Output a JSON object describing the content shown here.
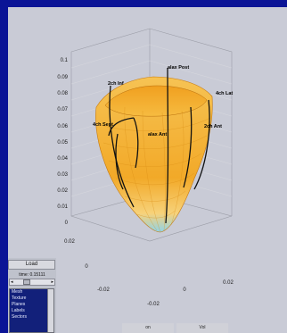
{
  "plot": {
    "z_ticks": [
      "0.1",
      "0.09",
      "0.08",
      "0.07",
      "0.06",
      "0.05",
      "0.04",
      "0.03",
      "0.02",
      "0.01",
      "0"
    ],
    "x_ticks": [
      "0.02",
      "0",
      "-0.02"
    ],
    "y_ticks": [
      "-0.02",
      "0",
      "0.02"
    ],
    "labels": {
      "two_ch_inf": "2ch Inf",
      "alax_post": "alax Post",
      "four_ch_lat": "4ch Lat",
      "four_ch_sept": "4ch Sept",
      "alax_ant": "alax Ant",
      "two_ch_ant": "2ch Ant"
    }
  },
  "controls": {
    "load_label": "Load",
    "time_label": "time: 0.15111",
    "slider_left": "◂",
    "slider_right": "▸",
    "list_items": [
      "Mesh",
      "Texture",
      "Planes",
      "Labels",
      "Sectors"
    ],
    "tab1_label": "on",
    "tab2_label": "Vol"
  },
  "colors": {
    "background": "#0b1496",
    "surface_main": "#f2b32e",
    "surface_apex": "#7ec8e0"
  }
}
